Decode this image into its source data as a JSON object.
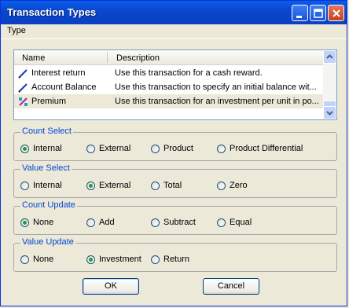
{
  "window": {
    "title": "Transaction Types"
  },
  "menubar": {
    "items": [
      "Type"
    ]
  },
  "list": {
    "columns": [
      "Name",
      "Description"
    ],
    "rows": [
      {
        "name": "Interest return",
        "description": "Use this transaction for a cash reward.",
        "icon": "pencil-icon",
        "selected": false
      },
      {
        "name": "Account Balance",
        "description": "Use this transaction to specify an initial balance wit...",
        "icon": "pencil-icon",
        "selected": false
      },
      {
        "name": "Premium",
        "description": "Use this transaction for an investment per unit in po...",
        "icon": "pencil-magenta-icon",
        "selected": true
      }
    ]
  },
  "groups": [
    {
      "label": "Count Select",
      "options": [
        "Internal",
        "External",
        "Product",
        "Product Differential"
      ],
      "selected": 0
    },
    {
      "label": "Value Select",
      "options": [
        "Internal",
        "External",
        "Total",
        "Zero"
      ],
      "selected": 1
    },
    {
      "label": "Count Update",
      "options": [
        "None",
        "Add",
        "Subtract",
        "Equal"
      ],
      "selected": 0
    },
    {
      "label": "Value Update",
      "options": [
        "None",
        "Investment",
        "Return"
      ],
      "selected": 1
    }
  ],
  "buttons": {
    "ok": "OK",
    "cancel": "Cancel"
  },
  "colors": {
    "titlebar": "#0a47cf",
    "group_label": "#0046d5",
    "radio_dot": "#21a121"
  }
}
